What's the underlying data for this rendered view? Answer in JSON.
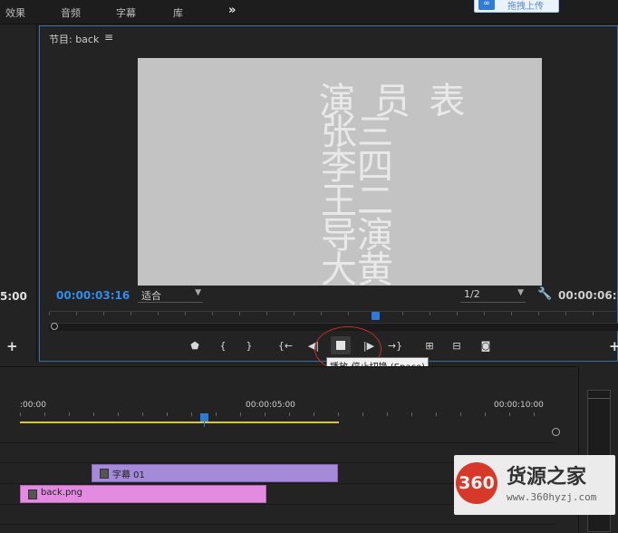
{
  "top_tabs": [
    "效果",
    "音频",
    "字幕",
    "库"
  ],
  "top_more": "»",
  "upload_button": {
    "label": "拖拽上传",
    "icon": "infinity-icon"
  },
  "source_monitor": {
    "timecode": "5:00",
    "add": "+"
  },
  "program_monitor": {
    "title": "节目: back",
    "menu": "≡",
    "video_text": [
      {
        "text": "演 员 表"
      },
      {
        "text": "张三"
      },
      {
        "text": "李四"
      },
      {
        "text": "王二"
      },
      {
        "text": "导演"
      },
      {
        "text": "大黄"
      }
    ],
    "current_time": "00:00:03:16",
    "fit": "适合",
    "resolution": "1/2",
    "end_time": "00:00:06:1",
    "controls": [
      {
        "name": "add-marker-button",
        "glyph": "⬤"
      },
      {
        "name": "mark-in-button",
        "glyph": "{"
      },
      {
        "name": "mark-out-button",
        "glyph": "}"
      },
      {
        "name": "go-to-in-button",
        "glyph": "{←"
      },
      {
        "name": "step-back-button",
        "glyph": "◀|"
      },
      {
        "name": "step-forward-button",
        "glyph": "|▶"
      },
      {
        "name": "go-to-out-button",
        "glyph": "→}"
      },
      {
        "name": "lift-button",
        "glyph": "⊞"
      },
      {
        "name": "extract-button",
        "glyph": "⊟"
      },
      {
        "name": "export-frame-button",
        "glyph": "◉"
      }
    ],
    "tooltip": "播放-停止切换 (Space)",
    "add": "+"
  },
  "timeline": {
    "ruler_labels": [
      ":00:00",
      "00:00:05:00",
      "00:00:10:00"
    ],
    "clips": [
      {
        "label": "字幕 01"
      },
      {
        "label": "back.png"
      }
    ]
  },
  "watermark": {
    "badge": "360",
    "name": "货源之家",
    "url": "www.360hyzj.com"
  }
}
